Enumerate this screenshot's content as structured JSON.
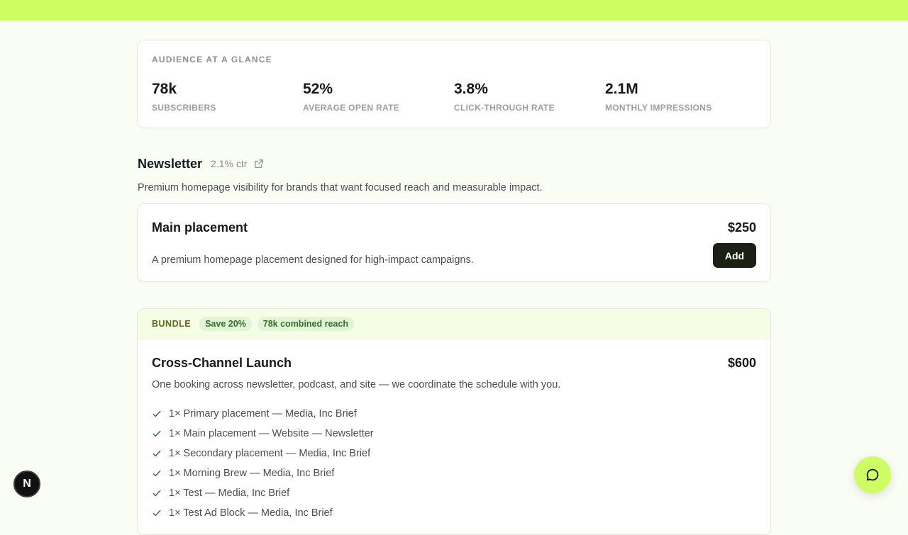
{
  "audience": {
    "title": "AUDIENCE AT A GLANCE",
    "stats": [
      {
        "value": "78k",
        "label": "SUBSCRIBERS"
      },
      {
        "value": "52%",
        "label": "AVERAGE OPEN RATE"
      },
      {
        "value": "3.8%",
        "label": "CLICK-THROUGH RATE"
      },
      {
        "value": "2.1M",
        "label": "MONTHLY IMPRESSIONS"
      }
    ]
  },
  "section": {
    "title": "Newsletter",
    "ctr": "2.1% ctr",
    "description": "Premium homepage visibility for brands that want focused reach and measurable impact."
  },
  "placement": {
    "title": "Main placement",
    "price": "$250",
    "description": "A premium homepage placement designed for high-impact campaigns.",
    "add_label": "Add"
  },
  "bundle": {
    "tag": "BUNDLE",
    "save_pill": "Save 20%",
    "reach_pill": "78k combined reach",
    "title": "Cross-Channel Launch",
    "price": "$600",
    "description": "One booking across newsletter, podcast, and site — we coordinate the schedule with you.",
    "items": [
      "1× Primary placement — Media, Inc Brief",
      "1× Main placement — Website — Newsletter",
      "1× Secondary placement — Media, Inc Brief",
      "1× Morning Brew — Media, Inc Brief",
      "1× Test — Media, Inc Brief",
      "1× Test Ad Block — Media, Inc Brief"
    ]
  },
  "floating": {
    "badge_letter": "N"
  },
  "icons": {
    "external": "external-link-icon",
    "check": "check-icon",
    "chat": "chat-bubble-icon"
  },
  "colors": {
    "accent": "#cdfc63",
    "button_dark": "#1b2013"
  }
}
